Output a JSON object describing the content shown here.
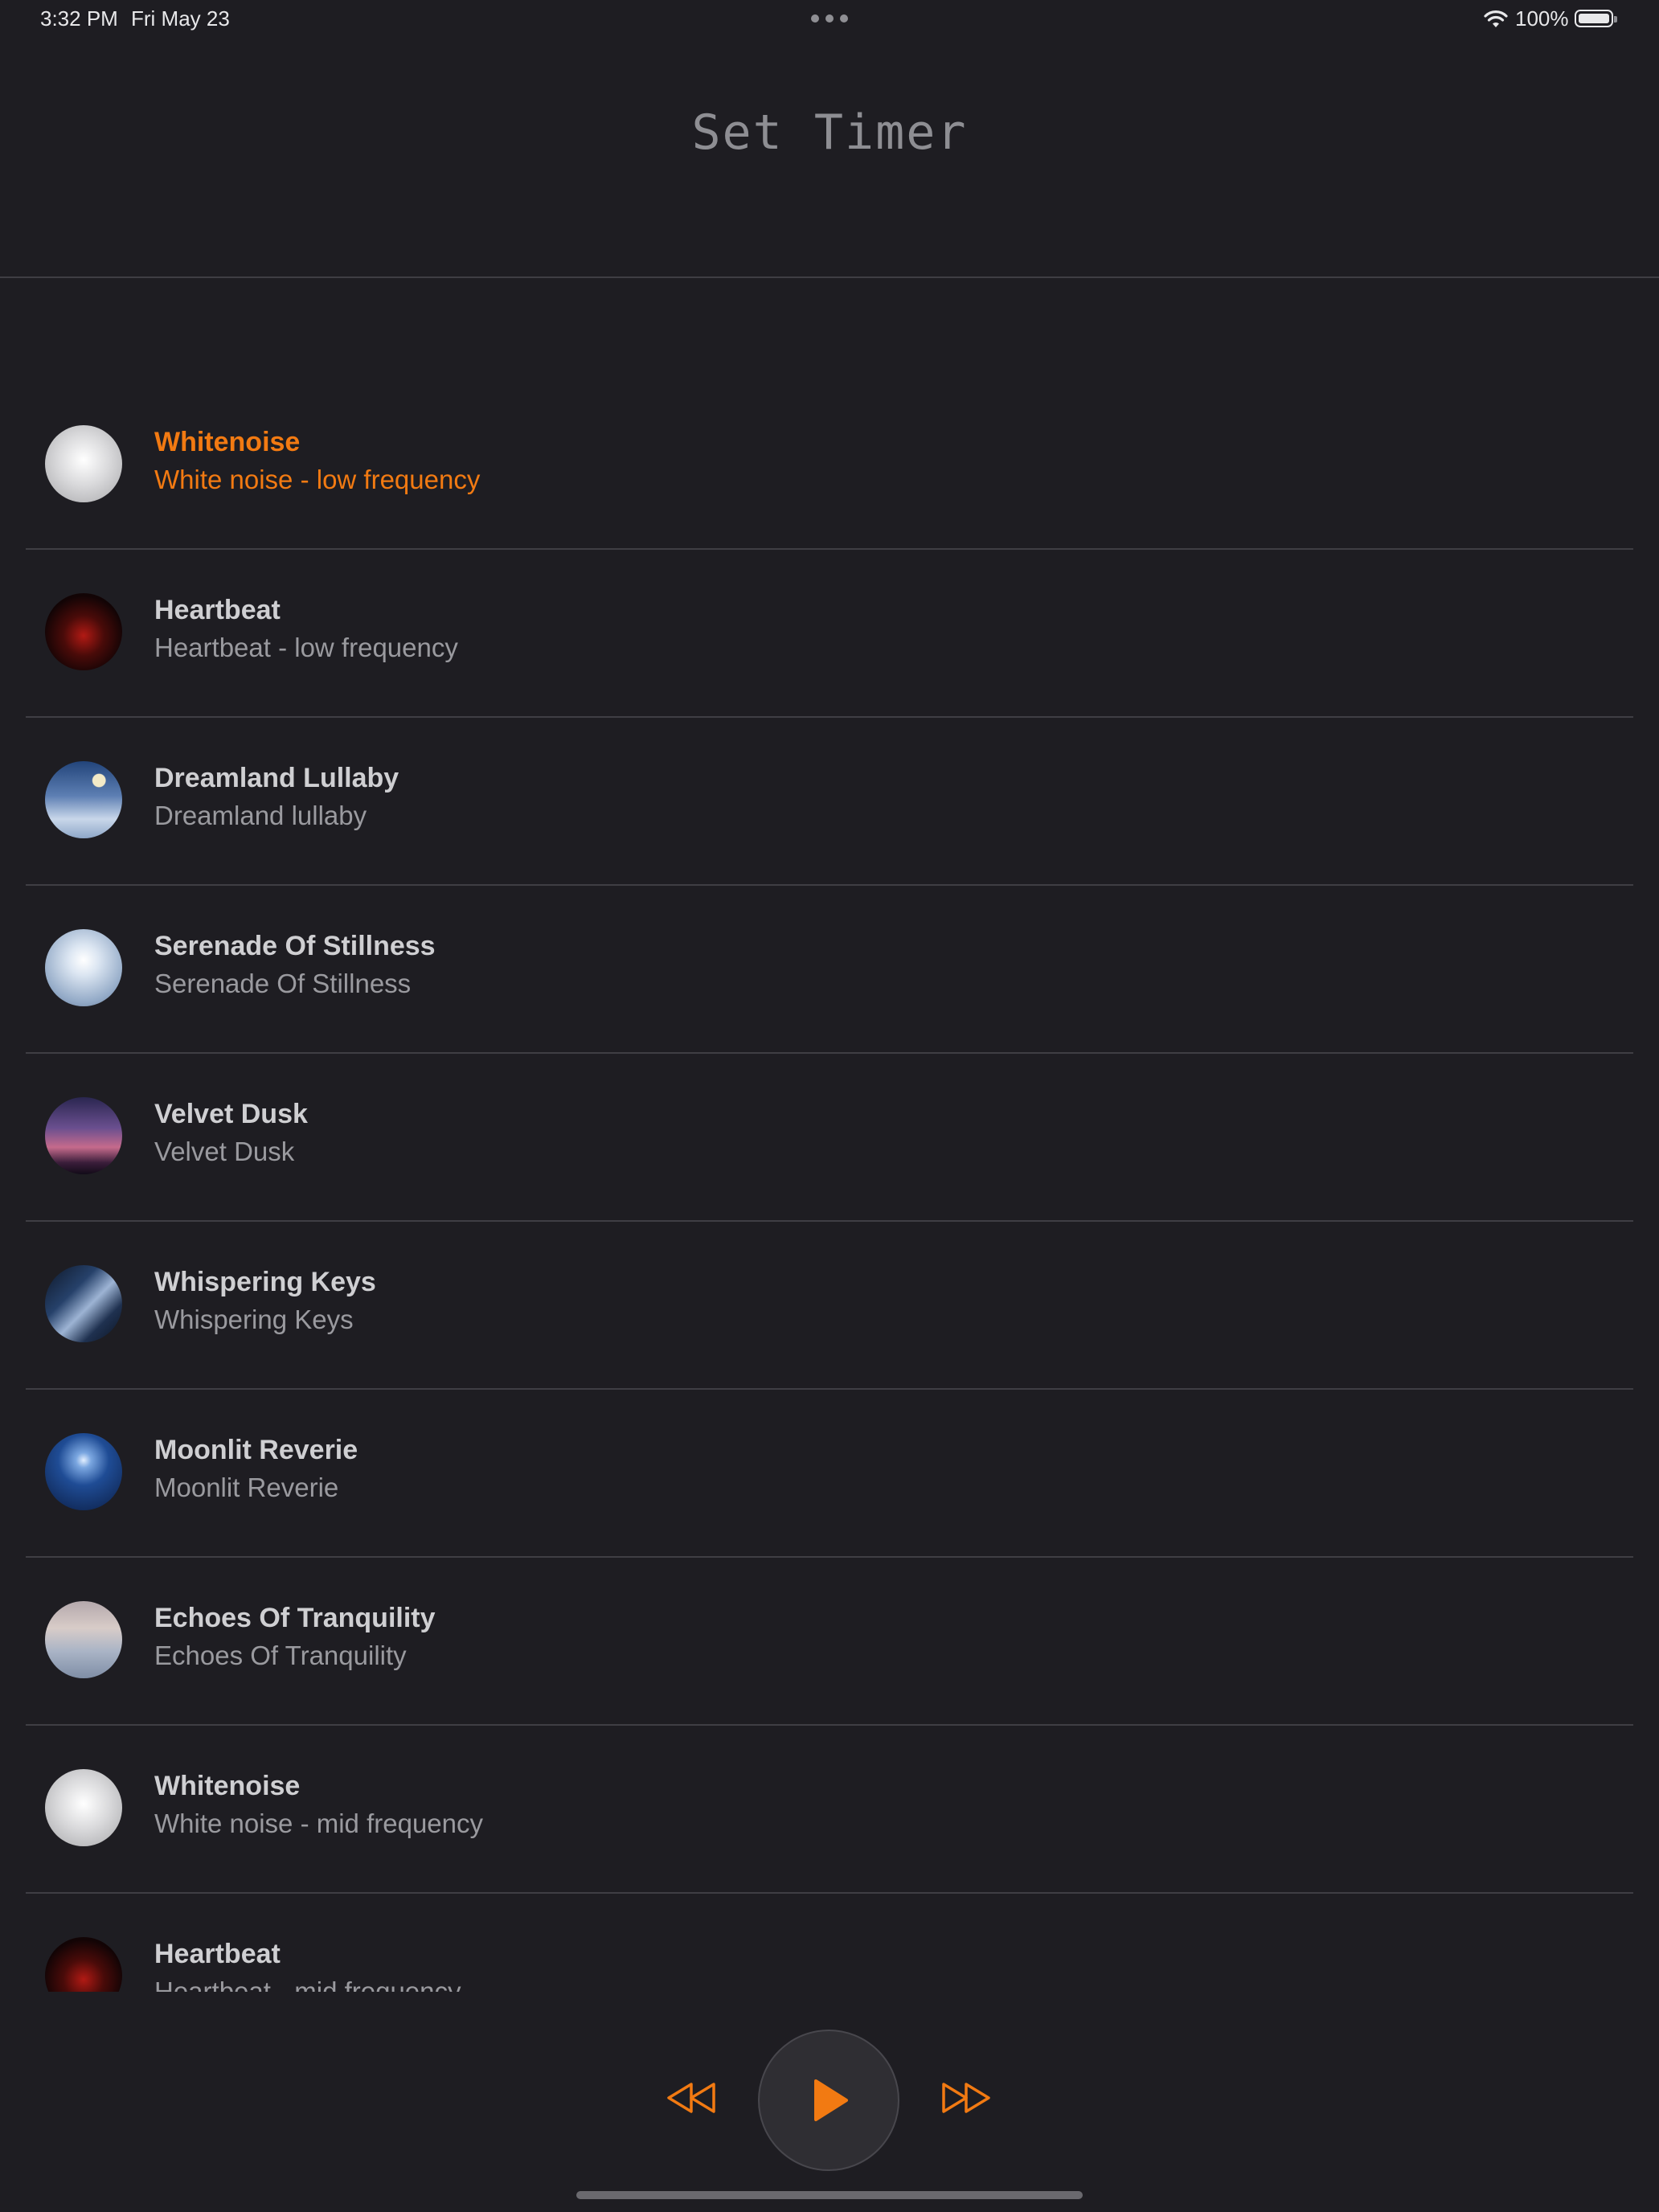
{
  "status_bar": {
    "time": "3:32 PM",
    "date": "Fri May 23",
    "battery": "100%"
  },
  "header": {
    "title": "Set Timer"
  },
  "tracks": [
    {
      "name": "Whitenoise",
      "desc": "White noise - low frequency",
      "active": true,
      "thumb": "white"
    },
    {
      "name": "Heartbeat",
      "desc": "Heartbeat - low frequency",
      "thumb": "heart"
    },
    {
      "name": "Dreamland Lullaby",
      "desc": "Dreamland lullaby",
      "thumb": "dream"
    },
    {
      "name": "Serenade Of Stillness",
      "desc": "Serenade Of Stillness",
      "thumb": "serenade"
    },
    {
      "name": "Velvet Dusk",
      "desc": "Velvet Dusk",
      "thumb": "velvet"
    },
    {
      "name": "Whispering Keys",
      "desc": "Whispering Keys",
      "thumb": "keys"
    },
    {
      "name": "Moonlit Reverie",
      "desc": "Moonlit Reverie",
      "thumb": "moon"
    },
    {
      "name": "Echoes Of Tranquility",
      "desc": "Echoes Of Tranquility",
      "thumb": "echo"
    },
    {
      "name": "Whitenoise",
      "desc": "White noise - mid frequency",
      "thumb": "white"
    },
    {
      "name": "Heartbeat",
      "desc": "Heartbeat - mid frequency",
      "thumb": "heart"
    }
  ],
  "controls": {
    "rewind_icon": "rewind-icon",
    "play_icon": "play-icon",
    "forward_icon": "fast-forward-icon"
  },
  "colors": {
    "accent": "#f27a12",
    "background": "#1e1d22"
  }
}
